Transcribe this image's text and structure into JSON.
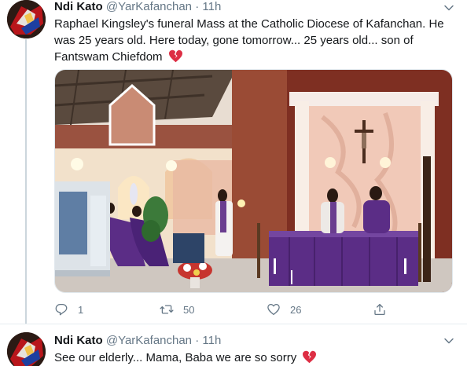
{
  "tweets": [
    {
      "name": "Ndi Kato",
      "handle": "@YarKafanchan",
      "separator": "·",
      "time": "11h",
      "text": "Raphael Kingsley's funeral Mass at the Catholic Diocese of Kafanchan. He was 25 years old. Here today, gone tomorrow... 25 years old... son of Fantswam Chiefdom",
      "emoji": "broken-heart-icon",
      "stats": {
        "replies": "1",
        "retweets": "50",
        "likes": "26"
      }
    },
    {
      "name": "Ndi Kato",
      "handle": "@YarKafanchan",
      "separator": "·",
      "time": "11h",
      "text": "See our elderly... Mama, Baba we are so sorry",
      "emoji": "broken-heart-icon"
    }
  ],
  "colors": {
    "text_primary": "#14171a",
    "text_secondary": "#657786",
    "divider": "#e6ecf0",
    "broken_heart": "#dd2e44",
    "altar_purple": "#5b2d86"
  },
  "icons": [
    "chevron-down-icon",
    "reply-icon",
    "retweet-icon",
    "like-icon",
    "share-icon",
    "broken-heart-icon"
  ]
}
